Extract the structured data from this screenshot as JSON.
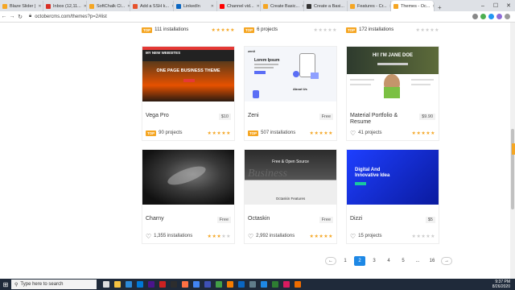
{
  "browser": {
    "tabs": [
      {
        "label": "Blaze Slider |",
        "color": "#f5a623"
      },
      {
        "label": "Inbox (12,11...",
        "color": "#d93025"
      },
      {
        "label": "SoftChalk Cl...",
        "color": "#f5a623"
      },
      {
        "label": "Add a SSH k...",
        "color": "#e6522c"
      },
      {
        "label": "LinkedIn",
        "color": "#0a66c2"
      },
      {
        "label": "Channel vid...",
        "color": "#ff0000"
      },
      {
        "label": "Create Basic...",
        "color": "#f5a623"
      },
      {
        "label": "Create a Basi...",
        "color": "#333333"
      },
      {
        "label": "Features - Cr...",
        "color": "#f5a623"
      },
      {
        "label": "Themes - Oc...",
        "color": "#f5a623"
      }
    ],
    "url": "octobercms.com/themes?p=2#list"
  },
  "top_row": [
    {
      "badge": "TOP",
      "text": "111 installations",
      "stars": 5
    },
    {
      "badge": "TOP",
      "text": "6 projects",
      "stars": 0
    },
    {
      "badge": "TOP",
      "text": "172 installations",
      "stars": 0
    }
  ],
  "themes": [
    {
      "title": "Vega Pro",
      "price": "$10",
      "badge": "TOP",
      "stat": "90 projects",
      "stars": 5,
      "heart": false
    },
    {
      "title": "Zeni",
      "price": "Free",
      "badge": "TOP",
      "stat": "507 installations",
      "stars": 5,
      "heart": false
    },
    {
      "title": "Material Portfolio & Resume",
      "price": "$9.90",
      "badge": "",
      "stat": "41 projects",
      "stars": 5,
      "heart": true
    },
    {
      "title": "Charny",
      "price": "Free",
      "badge": "",
      "stat": "1,355 installations",
      "stars": 2.5,
      "heart": true
    },
    {
      "title": "Octaskin",
      "price": "Free",
      "badge": "",
      "stat": "2,992 installations",
      "stars": 5,
      "heart": true
    },
    {
      "title": "Dizzi",
      "price": "$5",
      "badge": "",
      "stat": "15 projects",
      "stars": 0,
      "heart": true
    }
  ],
  "thumbs": {
    "vega": {
      "header": "MY NEW WEBSITES",
      "headline": "ONE PAGE BUSINESS THEME"
    },
    "zeni": {
      "brand": "zenii",
      "headline": "Lorem Ipsum",
      "section": "About Us"
    },
    "material": {
      "headline": "HI! I'M JANE DOE"
    },
    "octaskin": {
      "headline": "Free & Open Source",
      "word": "Business",
      "caption": "Octaskin Features"
    },
    "dizzi": {
      "headline_1": "Digital And",
      "headline_2": "Innovative Idea"
    }
  },
  "pagination": {
    "prev": "←",
    "pages": [
      "1",
      "2",
      "3",
      "4",
      "5",
      "...",
      "16"
    ],
    "active": "2",
    "next": "→"
  },
  "taskbar": {
    "search_placeholder": "Type here to search",
    "time": "9:37 PM",
    "date": "8/26/2020"
  }
}
